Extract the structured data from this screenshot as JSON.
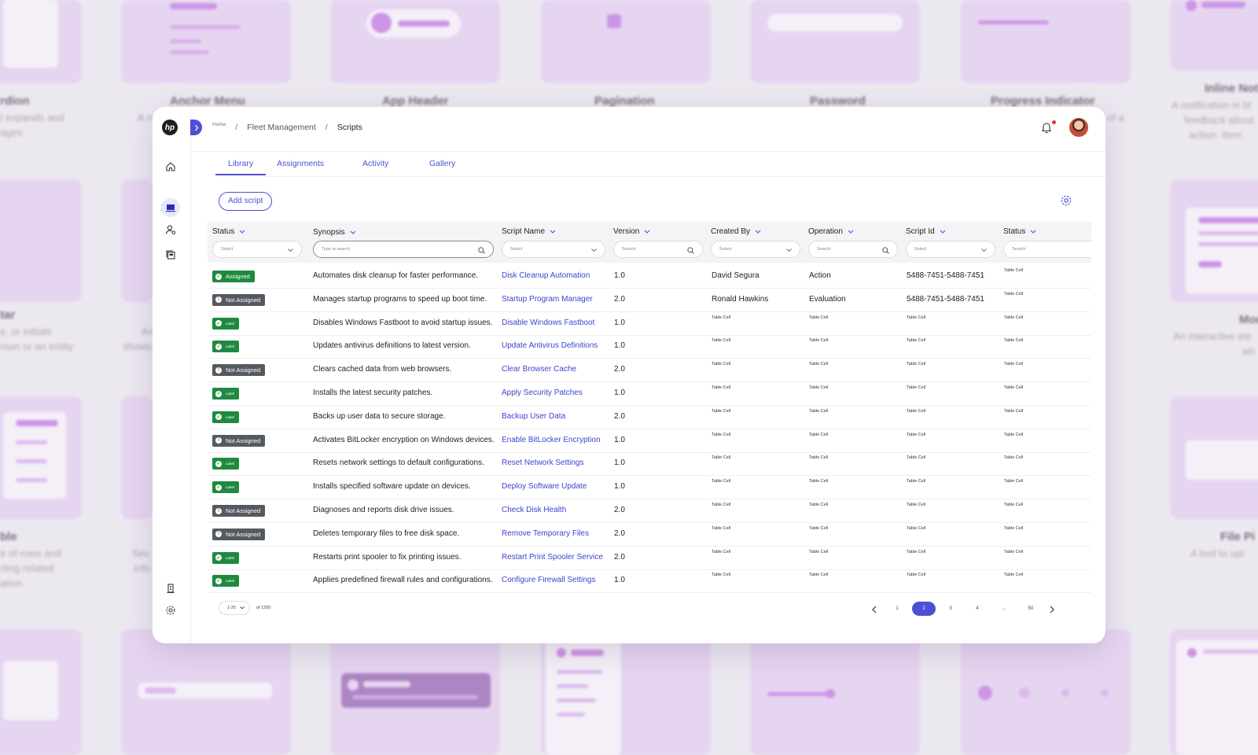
{
  "background": {
    "titles": [
      "rdion",
      "Anchor Menu",
      "App Header",
      "Pagination",
      "Password",
      "Progress Indicator",
      "Inline Not",
      "tar",
      "Mod",
      "ble",
      "File Pi"
    ],
    "descriptions": [
      "t expands and",
      "ages",
      "A n",
      "of a",
      "A notification in bl",
      "feedback about",
      "action. Item.",
      "e, or initials",
      "rson or an entity",
      "An",
      "shows",
      "An interactive ele",
      "wh",
      "e of rows and",
      "rting related",
      "ation",
      "Sev",
      "info",
      "A tool to upl"
    ]
  },
  "brand": {
    "logo_text": "hp",
    "accent": "#4b4fd6"
  },
  "breadcrumb": {
    "home": "Home",
    "section": "Fleet Management",
    "current": "Scripts",
    "separator": "/"
  },
  "tabs": [
    {
      "label": "Library",
      "active": true
    },
    {
      "label": "Assignments",
      "active": false
    },
    {
      "label": "Activity",
      "active": false
    },
    {
      "label": "Gallery",
      "active": false
    }
  ],
  "toolbar": {
    "add_label": "Add script"
  },
  "columns": [
    {
      "label": "Status",
      "filter": "Select"
    },
    {
      "label": "Synopsis",
      "filter": "Type to search"
    },
    {
      "label": "Script Name",
      "filter": "Select"
    },
    {
      "label": "Version",
      "filter": "Search"
    },
    {
      "label": "Created By",
      "filter": "Select"
    },
    {
      "label": "Operation",
      "filter": "Search"
    },
    {
      "label": "Script Id",
      "filter": "Select"
    },
    {
      "label": "Status",
      "filter": "Search"
    }
  ],
  "rows": [
    {
      "status": "Assigned",
      "status_type": "assigned",
      "synopsis": "Automates disk cleanup for faster performance.",
      "name": "Disk Cleanup Automation",
      "version": "1.0",
      "created_by": "David Segura",
      "operation": "Action",
      "script_id": "5488-7451-5488-7451",
      "status2": "Table Cell"
    },
    {
      "status": "Not Assigned",
      "status_type": "not-assigned",
      "synopsis": "Manages startup programs to speed up boot time.",
      "name": "Startup Program Manager",
      "version": "2.0",
      "created_by": "Ronald Hawkins",
      "operation": "Evaluation",
      "script_id": "5488-7451-5488-7451",
      "status2": "Table Cell"
    },
    {
      "status": "Label",
      "status_type": "label",
      "synopsis": "Disables Windows Fastboot to avoid startup issues.",
      "name": "Disable Windows Fastboot",
      "version": "1.0",
      "created_by": "Table Cell",
      "operation": "Table Cell",
      "script_id": "Table Cell",
      "status2": "Table Cell"
    },
    {
      "status": "Label",
      "status_type": "label",
      "synopsis": "Updates antivirus definitions to latest version.",
      "name": "Update Antivirus Definitions",
      "version": "1.0",
      "created_by": "Table Cell",
      "operation": "Table Cell",
      "script_id": "Table Cell",
      "status2": "Table Cell"
    },
    {
      "status": "Not Assigned",
      "status_type": "not-assigned",
      "synopsis": "Clears cached data from web browsers.",
      "name": "Clear Browser Cache",
      "version": "2.0",
      "created_by": "Table Cell",
      "operation": "Table Cell",
      "script_id": "Table Cell",
      "status2": "Table Cell"
    },
    {
      "status": "Label",
      "status_type": "label",
      "synopsis": "Installs the latest security patches.",
      "name": "Apply Security Patches",
      "version": "1.0",
      "created_by": "Table Cell",
      "operation": "Table Cell",
      "script_id": "Table Cell",
      "status2": "Table Cell"
    },
    {
      "status": "Label",
      "status_type": "label",
      "synopsis": "Backs up user data to secure storage.",
      "name": "Backup User Data",
      "version": "2.0",
      "created_by": "Table Cell",
      "operation": "Table Cell",
      "script_id": "Table Cell",
      "status2": "Table Cell"
    },
    {
      "status": "Not Assigned",
      "status_type": "not-assigned",
      "synopsis": "Activates BitLocker encryption on Windows devices.",
      "name": "Enable BitLocker Encryption",
      "version": "1.0",
      "created_by": "Table Cell",
      "operation": "Table Cell",
      "script_id": "Table Cell",
      "status2": "Table Cell"
    },
    {
      "status": "Label",
      "status_type": "label",
      "synopsis": "Resets network settings to default configurations.",
      "name": "Reset Network Settings",
      "version": "1.0",
      "created_by": "Table Cell",
      "operation": "Table Cell",
      "script_id": "Table Cell",
      "status2": "Table Cell"
    },
    {
      "status": "Label",
      "status_type": "label",
      "synopsis": "Installs specified software update on devices.",
      "name": "Deploy Software Update",
      "version": "1.0",
      "created_by": "Table Cell",
      "operation": "Table Cell",
      "script_id": "Table Cell",
      "status2": "Table Cell"
    },
    {
      "status": "Not Assigned",
      "status_type": "not-assigned",
      "synopsis": "Diagnoses and reports disk drive issues.",
      "name": "Check Disk Health",
      "version": "2.0",
      "created_by": "Table Cell",
      "operation": "Table Cell",
      "script_id": "Table Cell",
      "status2": "Table Cell"
    },
    {
      "status": "Not Assigned",
      "status_type": "not-assigned",
      "synopsis": "Deletes temporary files to free disk space.",
      "name": "Remove Temporary Files",
      "version": "2.0",
      "created_by": "Table Cell",
      "operation": "Table Cell",
      "script_id": "Table Cell",
      "status2": "Table Cell"
    },
    {
      "status": "Label",
      "status_type": "label",
      "synopsis": "Restarts print spooler to fix printing issues.",
      "name": "Restart Print Spooler Service",
      "version": "2.0",
      "created_by": "Table Cell",
      "operation": "Table Cell",
      "script_id": "Table Cell",
      "status2": "Table Cell"
    },
    {
      "status": "Label",
      "status_type": "label",
      "synopsis": "Applies predefined firewall rules and configurations.",
      "name": "Configure Firewall Settings",
      "version": "1.0",
      "created_by": "Table Cell",
      "operation": "Table Cell",
      "script_id": "Table Cell",
      "status2": "Table Cell"
    }
  ],
  "pagination": {
    "per_page": "1-25",
    "total": "of 1250",
    "pages": [
      "1",
      "2",
      "3",
      "4",
      "...",
      "50"
    ],
    "current": "2"
  }
}
